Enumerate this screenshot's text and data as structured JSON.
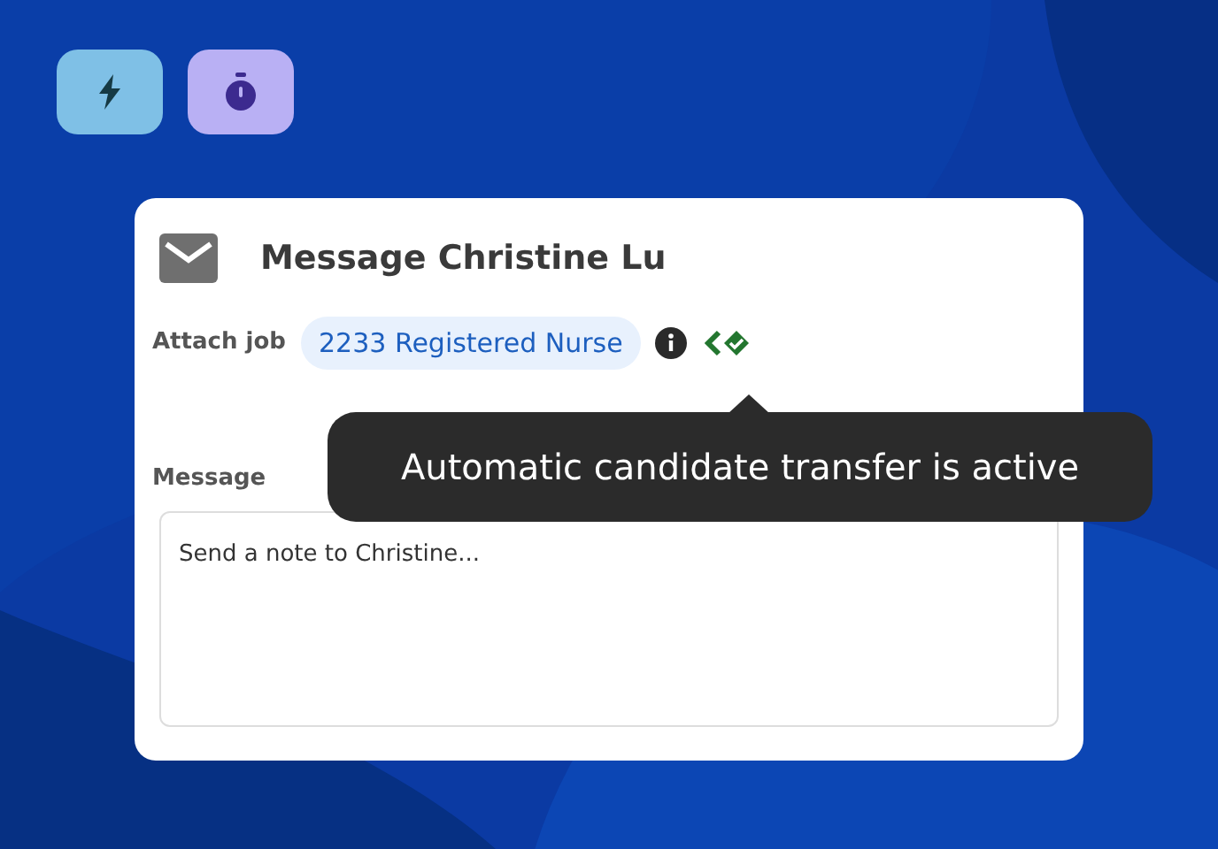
{
  "quick_actions": [
    {
      "kind": "bolt"
    },
    {
      "kind": "stopwatch"
    }
  ],
  "dialog": {
    "title": "Message Christine Lu",
    "attach_label": "Attach job",
    "job_chip": "2233 Registered Nurse",
    "tooltip": "Automatic candidate transfer is active",
    "message_label": "Message",
    "message": {
      "placeholder": "Send a note to Christine..."
    }
  }
}
